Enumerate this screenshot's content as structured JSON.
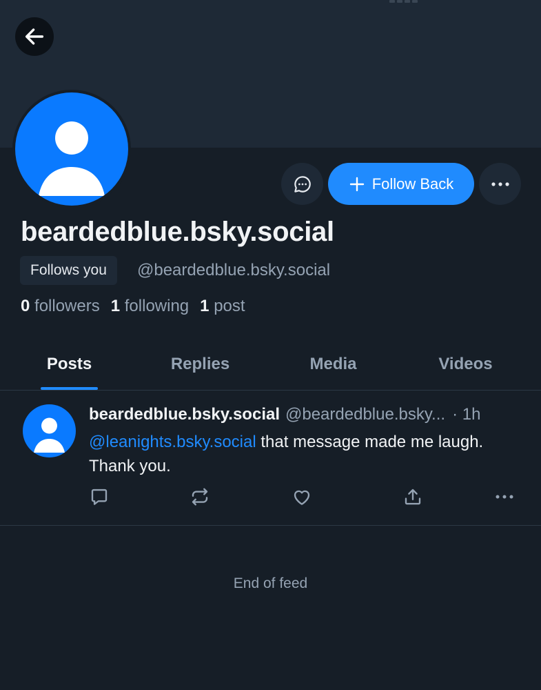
{
  "header": {
    "back_icon": "arrow-left-icon"
  },
  "profile": {
    "display_name": "beardedblue.bsky.social",
    "follows_you_label": "Follows you",
    "handle": "@beardedblue.bsky.social",
    "stats": {
      "followers_count": "0",
      "followers_label": "followers",
      "following_count": "1",
      "following_label": "following",
      "posts_count": "1",
      "posts_label": "post"
    }
  },
  "actions": {
    "message_icon": "chat-bubble-icon",
    "follow_label": "Follow Back",
    "follow_icon": "plus-icon",
    "more_icon": "ellipsis-icon"
  },
  "tabs": [
    {
      "label": "Posts",
      "active": true
    },
    {
      "label": "Replies",
      "active": false
    },
    {
      "label": "Media",
      "active": false
    },
    {
      "label": "Videos",
      "active": false
    }
  ],
  "post": {
    "author": "beardedblue.bsky.social",
    "handle": "@beardedblue.bsky...",
    "time": "· 1h",
    "mention": "@leanights.bsky.social",
    "text": " that message made me laugh.   Thank you.",
    "action_icons": [
      "reply-icon",
      "repost-icon",
      "like-icon",
      "share-icon",
      "ellipsis-icon"
    ]
  },
  "feed": {
    "end_label": "End of feed"
  },
  "colors": {
    "background": "#161e27",
    "banner": "#1e2936",
    "accent": "#208bfe",
    "muted_text": "#95a3b3",
    "primary_text": "#f1f3f5"
  }
}
